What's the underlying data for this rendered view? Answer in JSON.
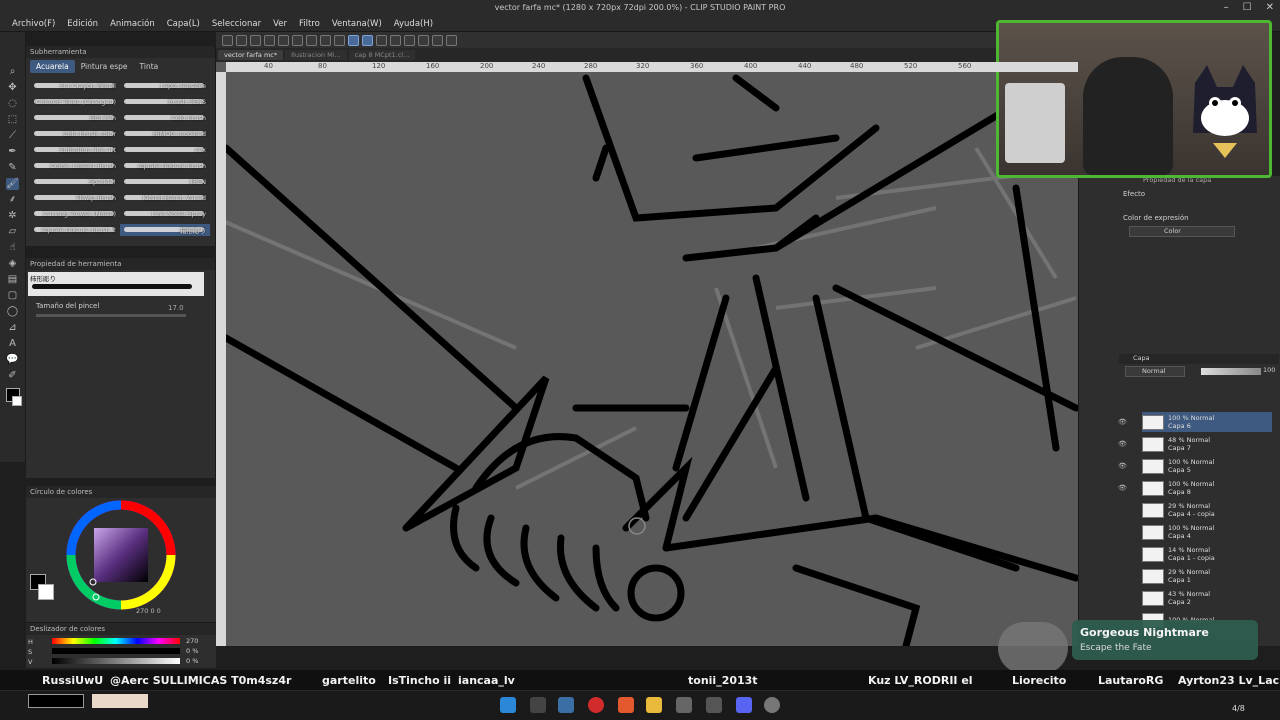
{
  "window": {
    "title": "vector farfa mc* (1280 x 720px 72dpi 200.0%) - CLIP STUDIO PAINT PRO"
  },
  "menu": [
    "Archivo(F)",
    "Edición",
    "Animación",
    "Capa(L)",
    "Seleccionar",
    "Ver",
    "Filtro",
    "Ventana(W)",
    "Ayuda(H)"
  ],
  "doc_tabs": [
    "vector farfa mc*",
    "Ilustracion Mi...",
    "cap 8 MCpt1.cl...",
    ""
  ],
  "ruler_ticks": [
    "40",
    "80",
    "120",
    "160",
    "200",
    "240",
    "280",
    "320",
    "360",
    "400",
    "440",
    "480",
    "520",
    "560"
  ],
  "sub_tool": {
    "header": "Subherramienta",
    "tabs": [
      "Acuarela",
      "Pintura espe",
      "Tinta"
    ],
    "brushes": [
      "Sui Crayon Pencil",
      "Lápiz sensible",
      "Colored Trees (Changed)",
      "brush SENS",
      "Bibi Pen",
      "Colo brush",
      "Colo brush color",
      "HIMOG modified",
      "Subsubus line art",
      "sex",
      "Comic Lineart Brush",
      "square texture brush",
      "Sparkle!",
      "4PEN",
      "Thwip Brush",
      "Kitsch Hatch Varied",
      "Carving Trowel (Noise)",
      "Line Noise Spray",
      "square texture brush 2",
      "箱形彫り"
    ]
  },
  "tool_property": {
    "header": "Propiedad de herramienta",
    "brush_name": "柿形彫り",
    "size_label": "Tamaño del pincel",
    "size_value": "17.0"
  },
  "color_circle": {
    "header": "Círculo de colores",
    "readout": "270 0 0"
  },
  "color_slider": {
    "header": "Deslizador de colores",
    "rows": [
      {
        "label": "H",
        "value": "270"
      },
      {
        "label": "S",
        "value": "0 %"
      },
      {
        "label": "V",
        "value": "0 %"
      }
    ]
  },
  "layer_property": {
    "header": "Propiedad de la capa",
    "effect_label": "Efecto",
    "expression_label": "Color de expresión",
    "expression_value": "Color"
  },
  "layers": {
    "header": "Capa",
    "blend_mode": "Normal",
    "opacity": "100",
    "items": [
      {
        "pct": "100 % Normal",
        "name": "Capa 6",
        "selected": true
      },
      {
        "pct": "48 % Normal",
        "name": "Capa 7",
        "selected": false
      },
      {
        "pct": "100 % Normal",
        "name": "Capa 5",
        "selected": false
      },
      {
        "pct": "100 % Normal",
        "name": "Capa 8",
        "selected": false
      },
      {
        "pct": "29 % Normal",
        "name": "Capa 4 - copia",
        "selected": false
      },
      {
        "pct": "100 % Normal",
        "name": "Capa 4",
        "selected": false
      },
      {
        "pct": "14 % Normal",
        "name": "Capa 1 - copia",
        "selected": false
      },
      {
        "pct": "29 % Normal",
        "name": "Capa 1",
        "selected": false
      },
      {
        "pct": "43 % Normal",
        "name": "Capa 2",
        "selected": false
      },
      {
        "pct": "100 % Normal",
        "name": "",
        "selected": false
      }
    ]
  },
  "now_playing": {
    "title": "Gorgeous Nightmare",
    "subtitle": "Escape the Fate"
  },
  "chat_names": [
    "RussiUwU",
    "@Aerc SULLIMICAS T0m4sz4r",
    "gartelito",
    "IsTincho ii",
    "iancaa_lv",
    "tonii_2013t",
    "Kuz LV_RODRII el",
    "Liorecito",
    "LautaroRG",
    "Ayrton23 Lv_Lacue"
  ],
  "taskbar": {
    "clock_fragment": "4/8"
  },
  "colors": {
    "accent": "#3f5a80",
    "webcam_border": "#4fb832",
    "canvas_bg": "#5b5b5b",
    "panel_bg": "#2e2e2e",
    "ink": "#000000"
  }
}
